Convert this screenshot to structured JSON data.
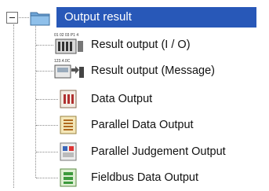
{
  "tree": {
    "root": {
      "label": "Output result",
      "expander": "minus",
      "icon": "folder-icon",
      "selected_color": "#2858b8"
    },
    "children": [
      {
        "label": "Result output (I / O)",
        "icon": "io-terminal-icon",
        "icon_text": "01 02 03 P1 4"
      },
      {
        "label": "Result output (Message)",
        "icon": "message-output-icon",
        "icon_text": "123.4.0C"
      },
      {
        "label": "Data Output",
        "icon": "data-output-icon"
      },
      {
        "label": "Parallel Data Output",
        "icon": "parallel-data-icon"
      },
      {
        "label": "Parallel Judgement Output",
        "icon": "parallel-judgement-icon"
      },
      {
        "label": "Fieldbus Data Output",
        "icon": "fieldbus-data-icon"
      }
    ]
  }
}
